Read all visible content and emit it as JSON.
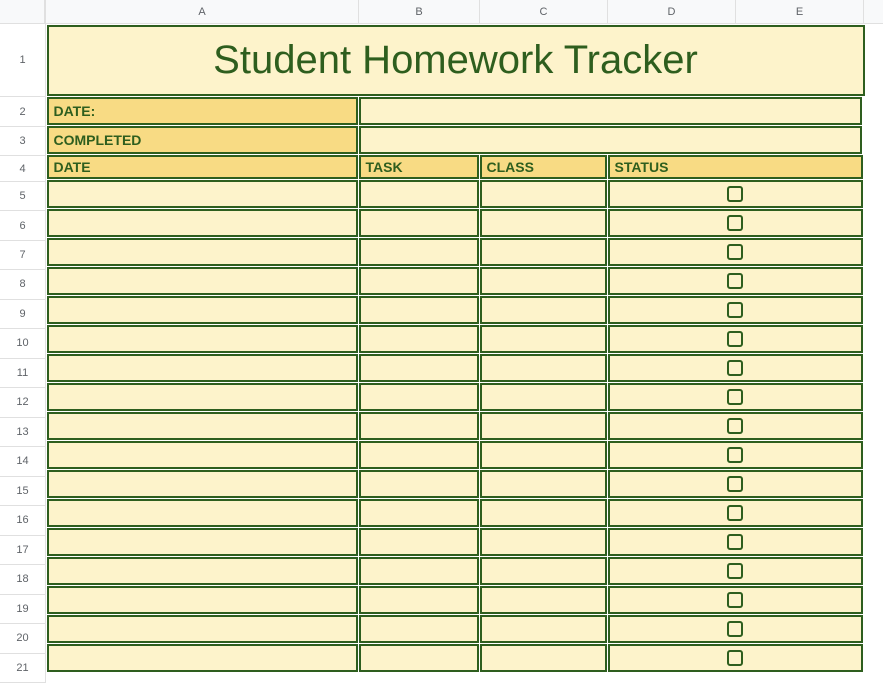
{
  "columns": [
    "A",
    "B",
    "C",
    "D",
    "E"
  ],
  "rows": [
    1,
    2,
    3,
    4,
    5,
    6,
    7,
    8,
    9,
    10,
    11,
    12,
    13,
    14,
    15,
    16,
    17,
    18,
    19,
    20,
    21
  ],
  "title": "Student Homework Tracker",
  "labels": {
    "date": "DATE:",
    "completed": "COMPLETED"
  },
  "headers": {
    "date": "DATE",
    "task": "TASK",
    "class": "CLASS",
    "status": "STATUS"
  },
  "dataRowCount": 17
}
